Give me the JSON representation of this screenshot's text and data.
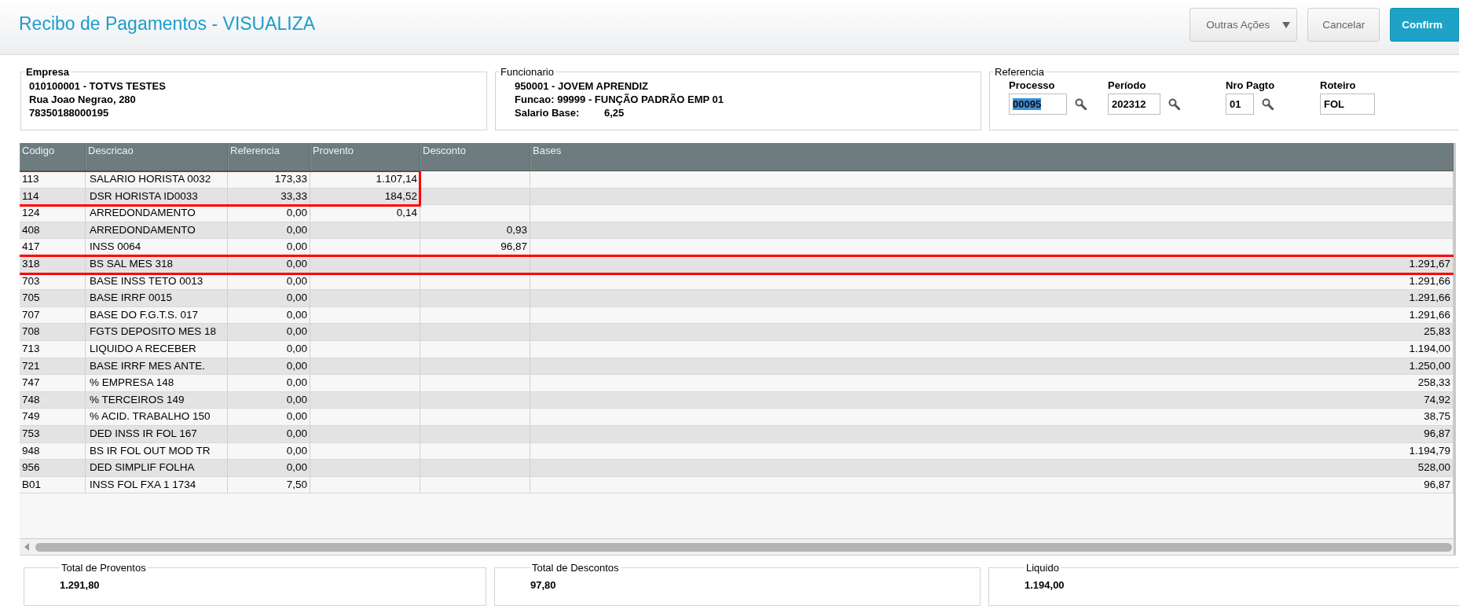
{
  "window": {
    "title": "Recibo de Pagamentos - VISUALIZA"
  },
  "actions": [
    {
      "label": "Outras Ações",
      "kind": "dropdown"
    },
    {
      "label": "Cancelar",
      "kind": "plain"
    },
    {
      "label": "Confirm",
      "kind": "primary"
    }
  ],
  "empresa": {
    "legend": "Empresa",
    "lines": [
      "010100001 - TOTVS TESTES",
      "Rua Joao Negrao, 280",
      "78350188000195"
    ]
  },
  "funcionario": {
    "legend": "Funcionario",
    "lines": [
      "950001 - JOVEM APRENDIZ",
      "Funcao: 99999 - FUNÇÃO PADRÃO EMP 01"
    ],
    "salary_label": "Salario Base:",
    "salary_value": "6,25"
  },
  "referencia": {
    "legend": "Referencia",
    "fields": [
      {
        "label": "Processo",
        "value": "00095",
        "text_selected": true,
        "lookup": true
      },
      {
        "label": "Período",
        "value": "202312",
        "text_selected": false,
        "lookup": true
      },
      {
        "label": "Nro Pagto",
        "value": "01",
        "text_selected": false,
        "lookup": true
      },
      {
        "label": "Roteiro",
        "value": "FOL",
        "text_selected": false,
        "lookup": false
      }
    ]
  },
  "table": {
    "columns": [
      "Codigo",
      "Descricao",
      "Referencia",
      "Provento",
      "Desconto",
      "Bases"
    ],
    "rows": [
      {
        "codigo": "113",
        "descricao": "SALARIO HORISTA 0032",
        "referencia": "173,33",
        "provento": "1.107,14",
        "framed": true,
        "frame_full_width": false
      },
      {
        "codigo": "114",
        "descricao": "DSR HORISTA ID0033",
        "referencia": "33,33",
        "provento": "184,52",
        "framed": true,
        "frame_full_width": false
      },
      {
        "codigo": "124",
        "descricao": "ARREDONDAMENTO",
        "referencia": "0,00",
        "provento": "0,14"
      },
      {
        "codigo": "408",
        "descricao": "ARREDONDAMENTO",
        "referencia": "0,00",
        "desconto": "0,93"
      },
      {
        "codigo": "417",
        "descricao": "INSS 0064",
        "referencia": "0,00",
        "desconto": "96,87"
      },
      {
        "codigo": "318",
        "descricao": "BS SAL MES 318",
        "referencia": "0,00",
        "bases": "1.291,67",
        "framed": true,
        "frame_full_width": true
      },
      {
        "codigo": "703",
        "descricao": "BASE INSS TETO 0013",
        "referencia": "0,00",
        "bases": "1.291,66"
      },
      {
        "codigo": "705",
        "descricao": "BASE IRRF 0015",
        "referencia": "0,00",
        "bases": "1.291,66"
      },
      {
        "codigo": "707",
        "descricao": "BASE DO F.G.T.S. 017",
        "referencia": "0,00",
        "bases": "1.291,66"
      },
      {
        "codigo": "708",
        "descricao": "FGTS DEPOSITO MES 18",
        "referencia": "0,00",
        "bases": "25,83"
      },
      {
        "codigo": "713",
        "descricao": "LIQUIDO A RECEBER",
        "referencia": "0,00",
        "bases": "1.194,00"
      },
      {
        "codigo": "721",
        "descricao": "BASE IRRF MES ANTE.",
        "referencia": "0,00",
        "bases": "1.250,00"
      },
      {
        "codigo": "747",
        "descricao": "% EMPRESA  148",
        "referencia": "0,00",
        "bases": "258,33"
      },
      {
        "codigo": "748",
        "descricao": "% TERCEIROS 149",
        "referencia": "0,00",
        "bases": "74,92"
      },
      {
        "codigo": "749",
        "descricao": "% ACID. TRABALHO 150",
        "referencia": "0,00",
        "bases": "38,75"
      },
      {
        "codigo": "753",
        "descricao": "DED INSS IR FOL 167",
        "referencia": "0,00",
        "bases": "96,87"
      },
      {
        "codigo": "948",
        "descricao": "BS IR FOL OUT MOD TR",
        "referencia": "0,00",
        "bases": "1.194,79"
      },
      {
        "codigo": "956",
        "descricao": "DED SIMPLIF FOLHA",
        "referencia": "0,00",
        "bases": "528,00"
      },
      {
        "codigo": "B01",
        "descricao": "INSS FOL FXA 1 1734",
        "referencia": "7,50",
        "bases": "96,87"
      }
    ]
  },
  "totals": [
    {
      "label": "Total de Proventos",
      "value": "1.291,80"
    },
    {
      "label": "Total de Descontos",
      "value": "97,80"
    },
    {
      "label": "Liquido",
      "value": "1.194,00"
    }
  ]
}
